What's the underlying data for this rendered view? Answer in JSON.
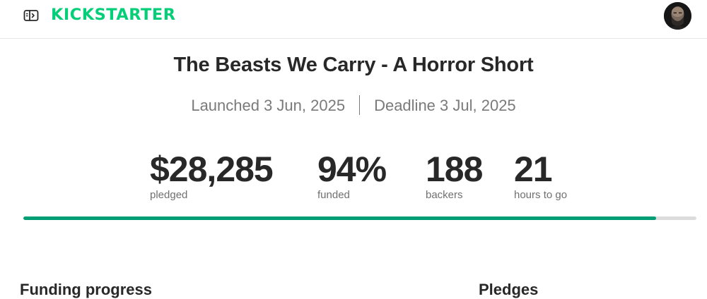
{
  "header": {
    "logo_text": "KICKSTARTER",
    "brand_color": "#05ce78",
    "sidebar_toggle_icon": "sidebar-toggle-icon",
    "avatar_icon": "user-avatar"
  },
  "project": {
    "title": "The Beasts We Carry - A Horror Short",
    "launched": "Launched 3 Jun, 2025",
    "deadline": "Deadline 3 Jul, 2025"
  },
  "stats": {
    "pledged": {
      "value": "$28,285",
      "label": "pledged"
    },
    "funded": {
      "value": "94%",
      "label": "funded"
    },
    "backers": {
      "value": "188",
      "label": "backers"
    },
    "time_left": {
      "value": "21",
      "label": "hours to go"
    }
  },
  "progress": {
    "fraction": 0.94,
    "fill_color": "#009e74",
    "track_color": "#dcdcdc"
  },
  "sections": {
    "funding_progress": "Funding progress",
    "pledges": "Pledges"
  }
}
